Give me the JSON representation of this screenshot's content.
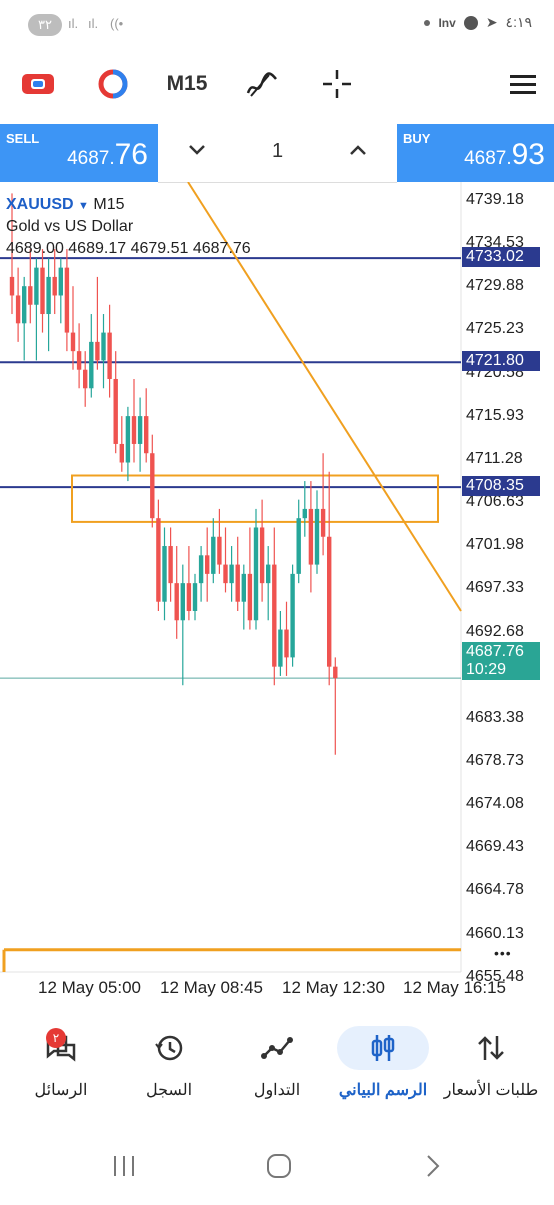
{
  "status_bar": {
    "notification_count": "٣٢",
    "time": "٤:١٩",
    "inv_label": "Inv"
  },
  "toolbar": {
    "timeframe": "M15"
  },
  "trade": {
    "sell_label": "SELL",
    "sell_price_main": "4687.",
    "sell_price_big": "76",
    "buy_label": "BUY",
    "buy_price_main": "4687.",
    "buy_price_big": "93",
    "volume": "1"
  },
  "chart": {
    "symbol": "XAUUSD",
    "symbol_arrow": "▼",
    "timeframe": "M15",
    "description": "Gold vs US Dollar",
    "ohlc": "4689.00 4689.17 4679.51 4687.76",
    "y_ticks": [
      "4739.18",
      "4734.53",
      "4729.88",
      "4725.23",
      "4720.58",
      "4715.93",
      "4711.28",
      "4706.63",
      "4701.98",
      "4697.33",
      "4692.68",
      "4683.38",
      "4678.73",
      "4674.08",
      "4669.43",
      "4664.78",
      "4660.13",
      "4655.48"
    ],
    "x_ticks": [
      "12 May 05:00",
      "12 May 08:45",
      "12 May 12:30",
      "12 May 16:15"
    ],
    "level_tags": [
      "4733.02",
      "4721.80",
      "4708.35"
    ],
    "current_price": "4687.76",
    "countdown": "10:29",
    "more_dots": "•••"
  },
  "chart_data": {
    "type": "candlestick",
    "symbol": "XAUUSD",
    "timeframe": "M15",
    "ylim": [
      4652,
      4742
    ],
    "horizontal_levels": [
      4733.02,
      4721.8,
      4708.35
    ],
    "rectangle": {
      "top": 4709.6,
      "bottom": 4704.6
    },
    "bid_line": 4687.76,
    "candles": [
      {
        "o": 4731,
        "h": 4740,
        "l": 4727,
        "c": 4729
      },
      {
        "o": 4729,
        "h": 4732,
        "l": 4724,
        "c": 4726
      },
      {
        "o": 4726,
        "h": 4731,
        "l": 4722,
        "c": 4730
      },
      {
        "o": 4730,
        "h": 4734,
        "l": 4726,
        "c": 4728
      },
      {
        "o": 4728,
        "h": 4733,
        "l": 4722,
        "c": 4732
      },
      {
        "o": 4732,
        "h": 4734,
        "l": 4725,
        "c": 4727
      },
      {
        "o": 4727,
        "h": 4733,
        "l": 4723,
        "c": 4731
      },
      {
        "o": 4731,
        "h": 4734,
        "l": 4727,
        "c": 4729
      },
      {
        "o": 4729,
        "h": 4733,
        "l": 4726,
        "c": 4732
      },
      {
        "o": 4732,
        "h": 4734,
        "l": 4723,
        "c": 4725
      },
      {
        "o": 4725,
        "h": 4730,
        "l": 4721,
        "c": 4723
      },
      {
        "o": 4723,
        "h": 4726,
        "l": 4719,
        "c": 4721
      },
      {
        "o": 4721,
        "h": 4723,
        "l": 4717,
        "c": 4719
      },
      {
        "o": 4719,
        "h": 4727,
        "l": 4718,
        "c": 4724
      },
      {
        "o": 4724,
        "h": 4731,
        "l": 4721,
        "c": 4722
      },
      {
        "o": 4722,
        "h": 4727,
        "l": 4719,
        "c": 4725
      },
      {
        "o": 4725,
        "h": 4728,
        "l": 4718,
        "c": 4720
      },
      {
        "o": 4720,
        "h": 4723,
        "l": 4712,
        "c": 4713
      },
      {
        "o": 4713,
        "h": 4716,
        "l": 4710,
        "c": 4711
      },
      {
        "o": 4711,
        "h": 4717,
        "l": 4709,
        "c": 4716
      },
      {
        "o": 4716,
        "h": 4720,
        "l": 4711,
        "c": 4713
      },
      {
        "o": 4713,
        "h": 4718,
        "l": 4710,
        "c": 4716
      },
      {
        "o": 4716,
        "h": 4719,
        "l": 4711,
        "c": 4712
      },
      {
        "o": 4712,
        "h": 4714,
        "l": 4704,
        "c": 4705
      },
      {
        "o": 4705,
        "h": 4707,
        "l": 4695,
        "c": 4696
      },
      {
        "o": 4696,
        "h": 4704,
        "l": 4694,
        "c": 4702
      },
      {
        "o": 4702,
        "h": 4704,
        "l": 4696,
        "c": 4698
      },
      {
        "o": 4698,
        "h": 4702,
        "l": 4692,
        "c": 4694
      },
      {
        "o": 4694,
        "h": 4700,
        "l": 4687,
        "c": 4698
      },
      {
        "o": 4698,
        "h": 4702,
        "l": 4694,
        "c": 4695
      },
      {
        "o": 4695,
        "h": 4699,
        "l": 4694,
        "c": 4698
      },
      {
        "o": 4698,
        "h": 4702,
        "l": 4696,
        "c": 4701
      },
      {
        "o": 4701,
        "h": 4704,
        "l": 4696,
        "c": 4699
      },
      {
        "o": 4699,
        "h": 4705,
        "l": 4698,
        "c": 4703
      },
      {
        "o": 4703,
        "h": 4706,
        "l": 4699,
        "c": 4700
      },
      {
        "o": 4700,
        "h": 4704,
        "l": 4697,
        "c": 4698
      },
      {
        "o": 4698,
        "h": 4702,
        "l": 4696,
        "c": 4700
      },
      {
        "o": 4700,
        "h": 4703,
        "l": 4695,
        "c": 4696
      },
      {
        "o": 4696,
        "h": 4700,
        "l": 4693,
        "c": 4699
      },
      {
        "o": 4699,
        "h": 4704,
        "l": 4693,
        "c": 4694
      },
      {
        "o": 4694,
        "h": 4706,
        "l": 4693,
        "c": 4704
      },
      {
        "o": 4704,
        "h": 4707,
        "l": 4696,
        "c": 4698
      },
      {
        "o": 4698,
        "h": 4702,
        "l": 4694,
        "c": 4700
      },
      {
        "o": 4700,
        "h": 4704,
        "l": 4687,
        "c": 4689
      },
      {
        "o": 4689,
        "h": 4695,
        "l": 4688,
        "c": 4693
      },
      {
        "o": 4693,
        "h": 4696,
        "l": 4688,
        "c": 4690
      },
      {
        "o": 4690,
        "h": 4700,
        "l": 4689,
        "c": 4699
      },
      {
        "o": 4699,
        "h": 4707,
        "l": 4698,
        "c": 4705
      },
      {
        "o": 4705,
        "h": 4709,
        "l": 4703,
        "c": 4706
      },
      {
        "o": 4706,
        "h": 4709,
        "l": 4697,
        "c": 4700
      },
      {
        "o": 4700,
        "h": 4708,
        "l": 4699,
        "c": 4706
      },
      {
        "o": 4706,
        "h": 4712,
        "l": 4701,
        "c": 4703
      },
      {
        "o": 4703,
        "h": 4710,
        "l": 4687,
        "c": 4689
      },
      {
        "o": 4689,
        "h": 4690,
        "l": 4679.51,
        "c": 4687.76
      }
    ]
  },
  "nav": {
    "items": [
      {
        "label": "الرسائل",
        "badge": "٢"
      },
      {
        "label": "السجل"
      },
      {
        "label": "التداول"
      },
      {
        "label": "الرسم البياني"
      },
      {
        "label": "طلبات الأسعار"
      }
    ]
  },
  "colors": {
    "sell_buy_bg": "#3d95f5",
    "bull": "#26a69a",
    "bear": "#ef5350",
    "level": "#2b3a8f",
    "trend": "#f0a020",
    "bid_tag": "#2aa595"
  }
}
